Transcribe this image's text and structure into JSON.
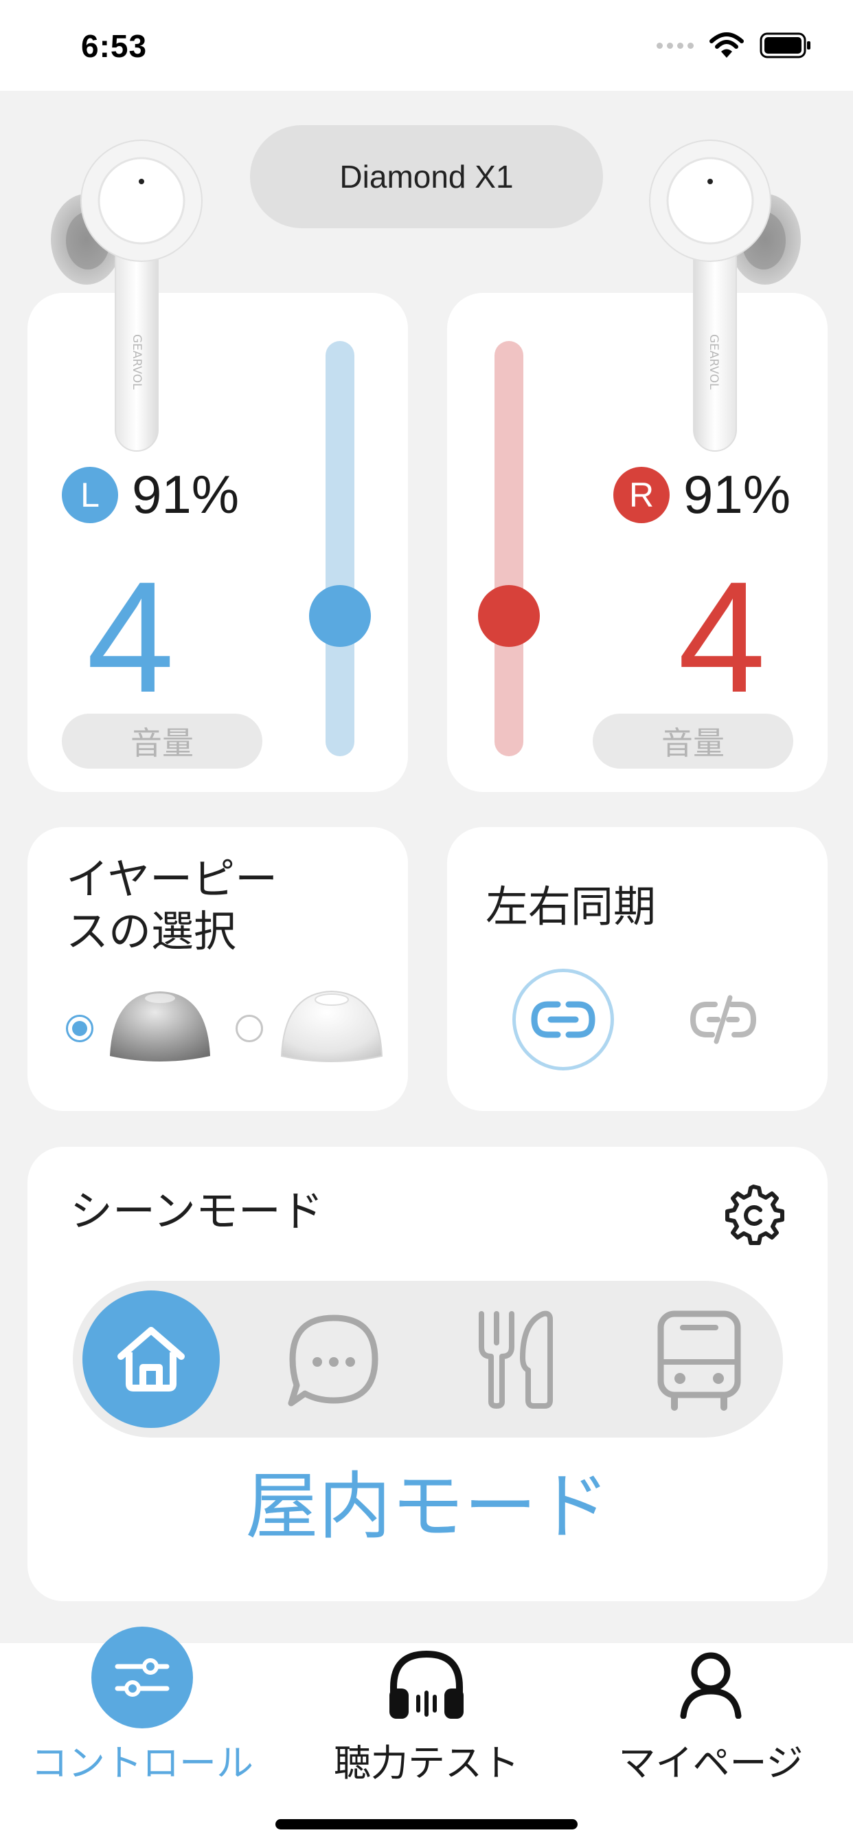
{
  "status_bar": {
    "time": "6:53"
  },
  "device": {
    "name": "Diamond X1",
    "brand_mark": "GEARVOL"
  },
  "left_ear": {
    "badge": "L",
    "battery": "91%",
    "volume_level": "4",
    "volume_label": "音量",
    "slider_fraction": 0.32,
    "color": "#5aa9e0",
    "track_color": "#c4def0"
  },
  "right_ear": {
    "badge": "R",
    "battery": "91%",
    "volume_level": "4",
    "volume_label": "音量",
    "slider_fraction": 0.32,
    "color": "#d7413a",
    "track_color": "#f0c3c3"
  },
  "eartip": {
    "title_line1": "イヤーピー",
    "title_line2": "スの選択",
    "options": [
      {
        "icon": "eartip-gray-icon",
        "selected": true
      },
      {
        "icon": "eartip-clear-icon",
        "selected": false
      }
    ]
  },
  "sync": {
    "title": "左右同期",
    "options": [
      {
        "icon": "link-icon",
        "selected": true
      },
      {
        "icon": "unlink-icon",
        "selected": false
      }
    ]
  },
  "scene": {
    "title": "シーンモード",
    "modes": [
      {
        "icon": "home-icon",
        "active": true
      },
      {
        "icon": "chat-bubble-icon",
        "active": false
      },
      {
        "icon": "fork-knife-icon",
        "active": false
      },
      {
        "icon": "bus-icon",
        "active": false
      }
    ],
    "current_mode": "屋内モード",
    "accent": "#5aa9e0"
  },
  "tabs": [
    {
      "label": "コントロール",
      "icon": "sliders-icon",
      "active": true
    },
    {
      "label": "聴力テスト",
      "icon": "headphones-icon",
      "active": false
    },
    {
      "label": "マイページ",
      "icon": "user-icon",
      "active": false
    }
  ]
}
